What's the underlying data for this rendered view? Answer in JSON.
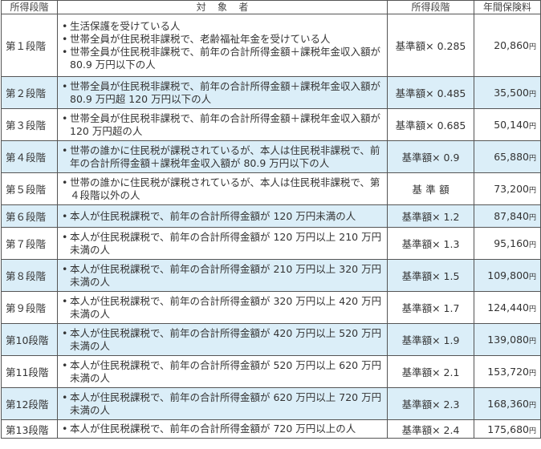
{
  "headers": {
    "stage": "所得段階",
    "target": "対象者",
    "level": "所得段階",
    "fee": "年間保険料"
  },
  "rows": [
    {
      "stage": "第１段階",
      "items": [
        "生活保護を受けている人",
        "世帯全員が住民税非課税で、老齢福祉年金を受けている人",
        "世帯全員が住民税非課税で、前年の合計所得金額＋課税年金収入額が 80.9 万円以下の人"
      ],
      "standard": "基準額× 0.285",
      "fee_amount": "20,860",
      "fee_unit": "円"
    },
    {
      "stage": "第２段階",
      "items": [
        "世帯全員が住民税非課税で、前年の合計所得金額＋課税年金収入額が 80.9 万円超 120 万円以下の人"
      ],
      "standard": "基準額× 0.485",
      "fee_amount": "35,500",
      "fee_unit": "円"
    },
    {
      "stage": "第３段階",
      "items": [
        "世帯全員が住民税非課税で、前年の合計所得金額＋課税年金収入額が 120 万円超の人"
      ],
      "standard": "基準額× 0.685",
      "fee_amount": "50,140",
      "fee_unit": "円"
    },
    {
      "stage": "第４段階",
      "items": [
        "世帯の誰かに住民税が課税されているが、本人は住民税非課税で、前年の合計所得金額＋課税年金収入額が 80.9 万円以下の人"
      ],
      "standard": "基準額× 0.9",
      "fee_amount": "65,880",
      "fee_unit": "円"
    },
    {
      "stage": "第５段階",
      "items": [
        "世帯の誰かに住民税が課税されているが、本人は住民税非課税で、第４段階以外の人"
      ],
      "standard": "基準額",
      "fee_amount": "73,200",
      "fee_unit": "円"
    },
    {
      "stage": "第６段階",
      "items": [
        "本人が住民税課税で、前年の合計所得金額が 120 万円未満の人"
      ],
      "standard": "基準額× 1.2",
      "fee_amount": "87,840",
      "fee_unit": "円"
    },
    {
      "stage": "第７段階",
      "items": [
        "本人が住民税課税で、前年の合計所得金額が 120 万円以上 210 万円未満の人"
      ],
      "standard": "基準額× 1.3",
      "fee_amount": "95,160",
      "fee_unit": "円"
    },
    {
      "stage": "第８段階",
      "items": [
        "本人が住民税課税で、前年の合計所得金額が 210 万円以上 320 万円未満の人"
      ],
      "standard": "基準額× 1.5",
      "fee_amount": "109,800",
      "fee_unit": "円"
    },
    {
      "stage": "第９段階",
      "items": [
        "本人が住民税課税で、前年の合計所得金額が 320 万円以上 420 万円未満の人"
      ],
      "standard": "基準額× 1.7",
      "fee_amount": "124,440",
      "fee_unit": "円"
    },
    {
      "stage": "第10段階",
      "items": [
        "本人が住民税課税で、前年の合計所得金額が 420 万円以上 520 万円未満の人"
      ],
      "standard": "基準額× 1.9",
      "fee_amount": "139,080",
      "fee_unit": "円"
    },
    {
      "stage": "第11段階",
      "items": [
        "本人が住民税課税で、前年の合計所得金額が 520 万円以上 620 万円未満の人"
      ],
      "standard": "基準額× 2.1",
      "fee_amount": "153,720",
      "fee_unit": "円"
    },
    {
      "stage": "第12段階",
      "items": [
        "本人が住民税課税で、前年の合計所得金額が 620 万円以上 720 万円未満の人"
      ],
      "standard": "基準額× 2.3",
      "fee_amount": "168,360",
      "fee_unit": "円"
    },
    {
      "stage": "第13段階",
      "items": [
        "本人が住民税課税で、前年の合計所得金額が 720 万円以上の人"
      ],
      "standard": "基準額× 2.4",
      "fee_amount": "175,680",
      "fee_unit": "円"
    }
  ]
}
